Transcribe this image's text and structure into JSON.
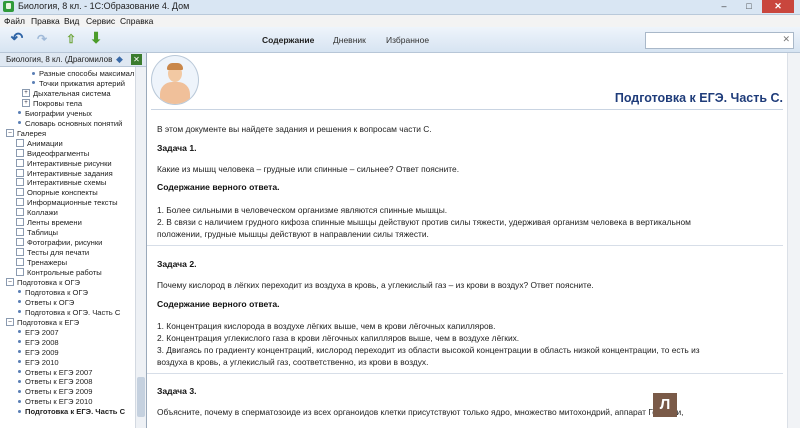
{
  "window": {
    "title": "Биология, 8 кл. - 1С:Образование 4. Дом",
    "min": "–",
    "max": "□",
    "close": "✕"
  },
  "menu": [
    "Файл",
    "Правка",
    "Вид",
    "Сервис",
    "Справка"
  ],
  "toolbar": {
    "nav": [
      "Содержание",
      "Дневник",
      "Избранное"
    ],
    "active_nav": "Содержание",
    "search_value": "",
    "search_clear": "✕"
  },
  "sidebar": {
    "header": "Биология, 8 кл. (Драгомилов",
    "items": [
      {
        "text": "Разные способы максимал",
        "level": 3,
        "mk": "dot"
      },
      {
        "text": "Точки прижатия артерий",
        "level": 3,
        "mk": "dot"
      },
      {
        "text": "Дыхательная система",
        "level": 2,
        "mk": "plus"
      },
      {
        "text": "Покровы тела",
        "level": 2,
        "mk": "plus"
      },
      {
        "text": "Биографии ученых",
        "level": 1,
        "mk": "dot"
      },
      {
        "text": "Словарь основных понятий",
        "level": 1,
        "mk": "dot"
      },
      {
        "text": "Галерея",
        "level": 0,
        "mk": "minus"
      },
      {
        "text": "Анимации",
        "level": 1,
        "mk": "box"
      },
      {
        "text": "Видеофрагменты",
        "level": 1,
        "mk": "box"
      },
      {
        "text": "Интерактивные рисунки",
        "level": 1,
        "mk": "box"
      },
      {
        "text": "Интерактивные задания",
        "level": 1,
        "mk": "box"
      },
      {
        "text": "Интерактивные схемы",
        "level": 1,
        "mk": "box"
      },
      {
        "text": "Опорные конспекты",
        "level": 1,
        "mk": "box"
      },
      {
        "text": "Информационные тексты",
        "level": 1,
        "mk": "box"
      },
      {
        "text": "Коллажи",
        "level": 1,
        "mk": "box"
      },
      {
        "text": "Ленты времени",
        "level": 1,
        "mk": "box"
      },
      {
        "text": "Таблицы",
        "level": 1,
        "mk": "box"
      },
      {
        "text": "Фотографии, рисунки",
        "level": 1,
        "mk": "box"
      },
      {
        "text": "Тесты для печати",
        "level": 1,
        "mk": "box"
      },
      {
        "text": "Тренажеры",
        "level": 1,
        "mk": "box"
      },
      {
        "text": "Контрольные работы",
        "level": 1,
        "mk": "box"
      },
      {
        "text": "Подготовка к ОГЭ",
        "level": 0,
        "mk": "minus"
      },
      {
        "text": "Подготовка к ОГЭ",
        "level": 1,
        "mk": "dot"
      },
      {
        "text": "Ответы к ОГЭ",
        "level": 1,
        "mk": "dot"
      },
      {
        "text": "Подготовка к ОГЭ. Часть С",
        "level": 1,
        "mk": "dot"
      },
      {
        "text": "Подготовка к ЕГЭ",
        "level": 0,
        "mk": "minus"
      },
      {
        "text": "ЕГЭ 2007",
        "level": 1,
        "mk": "dot"
      },
      {
        "text": "ЕГЭ 2008",
        "level": 1,
        "mk": "dot"
      },
      {
        "text": "ЕГЭ 2009",
        "level": 1,
        "mk": "dot"
      },
      {
        "text": "ЕГЭ 2010",
        "level": 1,
        "mk": "dot"
      },
      {
        "text": "Ответы к ЕГЭ 2007",
        "level": 1,
        "mk": "dot"
      },
      {
        "text": "Ответы к ЕГЭ 2008",
        "level": 1,
        "mk": "dot"
      },
      {
        "text": "Ответы к ЕГЭ 2009",
        "level": 1,
        "mk": "dot"
      },
      {
        "text": "Ответы к ЕГЭ 2010",
        "level": 1,
        "mk": "dot"
      },
      {
        "text": "Подготовка к ЕГЭ. Часть С",
        "level": 1,
        "mk": "dot",
        "selected": true
      }
    ]
  },
  "content": {
    "title": "Подготовка к ЕГЭ. Часть С.",
    "intro": "В этом документе вы найдете задания и решения к вопросам части С.",
    "tasks": [
      {
        "heading": "Задача 1.",
        "question": "Какие из мышц человека – грудные или спинные – сильнее? Ответ поясните.",
        "answer_heading": "Содержание верного ответа.",
        "answers": [
          "1. Более сильными в человеческом организме являются спинные мышцы.",
          "2. В связи с наличием грудного кифоза спинные мышцы действуют против силы тяжести, удерживая организм человека в вертикальном",
          "положении, грудные мышцы действуют в направлении силы тяжести."
        ]
      },
      {
        "heading": "Задача 2.",
        "question": "Почему кислород в лёгких переходит из воздуха в кровь, а углекислый газ – из крови в воздух? Ответ поясните.",
        "answer_heading": "Содержание верного ответа.",
        "answers": [
          "1. Концентрация кислорода в воздухе лёгких выше, чем в крови лёгочных капилляров.",
          "2. Концентрация углекислого газа в крови лёгочных капилляров выше, чем в воздухе лёгких.",
          "3. Двигаясь по градиенту концентраций, кислород переходит из области высокой концентрации в область низкой концентрации, то есть из",
          "воздуха в кровь, а углекислый газ, соответственно, из крови в воздух."
        ]
      },
      {
        "heading": "Задача 3.",
        "question": "Объясните, почему в сперматозоиде из всех органоидов клетки присутствуют только ядро, множество митохондрий, аппарат Гольджи,"
      }
    ]
  },
  "watermark": "Л"
}
